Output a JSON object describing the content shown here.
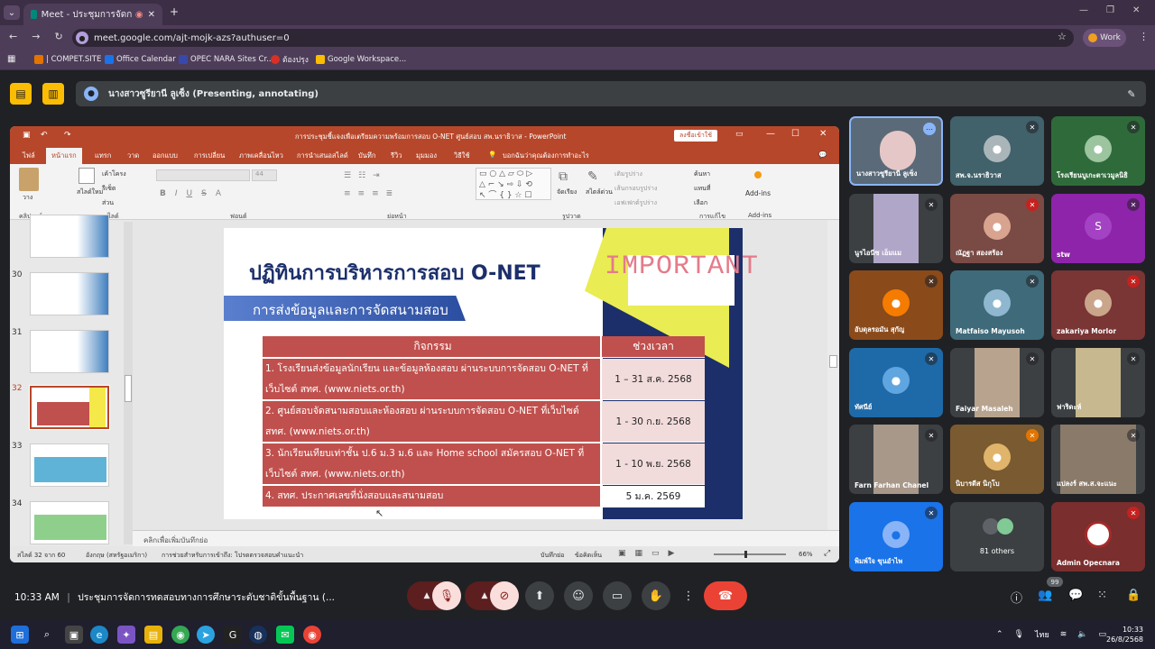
{
  "browser": {
    "tab_title": "Meet - ประชุมการจัดการทดสอบ...",
    "url": "meet.google.com/ajt-mojk-azs?authuser=0",
    "profile_label": "Work",
    "bookmarks": [
      "| COMPET.SITE",
      "Office Calendar",
      "OPEC NARA Sites Cr...",
      "ต้องปรุง",
      "Google Workspace..."
    ]
  },
  "meet": {
    "presenter_text": "นางสาวซูรียานี ลูเซ็ง (Presenting, annotating)",
    "time": "10:33 AM",
    "meeting_title": "ประชุมการจัดการทดสอบทางการศึกษาระดับชาติขั้นพื้นฐาน (...",
    "people_badge": "99"
  },
  "ppt": {
    "title": "การประชุมชี้แจงเพื่อเตรียมความพร้อมการสอบ O-NET ศูนย์สอบ สพ.นราธิวาส - PowerPoint",
    "share_button": "ลงชื่อเข้าใช้",
    "menu": [
      "ไฟล์",
      "หน้าแรก",
      "แทรก",
      "วาด",
      "ออกแบบ",
      "การเปลี่ยน",
      "ภาพเคลื่อนไหว",
      "การนำเสนอสไลด์",
      "บันทึก",
      "รีวิว",
      "มุมมอง",
      "วิธีใช้",
      "บอกฉันว่าคุณต้องการทำอะไร"
    ],
    "ribbon_groups": [
      "คลิปบอร์ด",
      "สไลด์",
      "ฟอนต์",
      "ย่อหน้า",
      "รูปวาด",
      "การแก้ไข",
      "Add-ins"
    ],
    "ribbon_items": {
      "paste": "วาง",
      "new_slide": "สไลด์ใหม่",
      "layout": "เค้าโครง",
      "reset": "รีเซ็ต",
      "section": "ส่วน",
      "font_size": "44",
      "find": "ค้นหา",
      "replace": "แทนที่",
      "select": "เลือก",
      "addins": "Add-ins",
      "arrange": "จัดเรียง",
      "quick_styles": "สไตล์ด่วน",
      "shape_fill": "เติมรูปร่าง",
      "shape_outline": "เส้นกรอบรูปร่าง",
      "shape_effects": "เอฟเฟกต์รูปร่าง"
    },
    "slide_numbers": [
      "30",
      "31",
      "32",
      "33",
      "34"
    ],
    "notes_placeholder": "คลิกเพื่อเพิ่มบันทึกย่อ",
    "status": {
      "slide": "สไลด์ 32 จาก 60",
      "language": "อังกฤษ (สหรัฐอเมริกา)",
      "accessibility": "การช่วยสำหรับการเข้าถึง: โปรดตรวจสอบคำแนะนำ",
      "notes": "บันทึกย่อ",
      "comments": "ข้อคิดเห็น",
      "zoom": "66%"
    }
  },
  "slide": {
    "title": "ปฏิทินการบริหารการสอบ O-NET",
    "subtitle": "การส่งข้อมูลและการจัดสนามสอบ",
    "important": "IMPORTANT",
    "table": {
      "headers": [
        "กิจกรรม",
        "ช่วงเวลา"
      ],
      "rows": [
        {
          "activity": "1. โรงเรียนส่งข้อมูลนักเรียน และข้อมูลห้องสอบ ผ่านระบบการจัดสอบ O-NET ที่เว็บไซต์ สทศ. (www.niets.or.th)",
          "period": "1 – 31 ส.ค. 2568"
        },
        {
          "activity": "2. ศูนย์สอบจัดสนามสอบและห้องสอบ ผ่านระบบการจัดสอบ O-NET ที่เว็บไซต์ สทศ. (www.niets.or.th)",
          "period": "1 - 30 ก.ย. 2568"
        },
        {
          "activity": "3. นักเรียนเทียบเท่าชั้น ป.6 ม.3 ม.6 และ Home school สมัครสอบ O-NET ที่เว็บไซต์ สทศ. (www.niets.or.th)",
          "period": "1 - 10 พ.ย. 2568"
        },
        {
          "activity": "4. สทศ. ประกาศเลขที่นั่งสอบและสนามสอบ",
          "period": "5 ม.ค. 2569"
        }
      ]
    }
  },
  "participants": [
    {
      "name": "นางสาวซูรียานี ลูเซ็ง",
      "muted": false,
      "initial": ""
    },
    {
      "name": "สพ.จ.นราธิวาส",
      "muted": true,
      "initial": ""
    },
    {
      "name": "โรงเรียนบูเกะตาเวมูลนิธิ",
      "muted": true,
      "initial": ""
    },
    {
      "name": "นูรไอนีซ เอ็มแม",
      "muted": true,
      "initial": ""
    },
    {
      "name": "ณัฏฐา สองสร้อง",
      "muted": true,
      "initial": ""
    },
    {
      "name": "stw",
      "muted": true,
      "initial": "S"
    },
    {
      "name": "อับดุลรอมัน สุกัญ",
      "muted": true,
      "initial": ""
    },
    {
      "name": "Matfaiso Mayusoh",
      "muted": true,
      "initial": ""
    },
    {
      "name": "zakariya Morlor",
      "muted": true,
      "initial": ""
    },
    {
      "name": "ทัศนีย์",
      "muted": true,
      "initial": ""
    },
    {
      "name": "Faiyar Masaleh",
      "muted": true,
      "initial": ""
    },
    {
      "name": "ฟาริดะห์",
      "muted": true,
      "initial": ""
    },
    {
      "name": "Farn Farhan Chanel",
      "muted": true,
      "initial": ""
    },
    {
      "name": "นิบารดีส นิกุโบ",
      "muted": true,
      "initial": ""
    },
    {
      "name": "แปลงร์ สพ.ส.จะแนะ",
      "muted": true,
      "initial": ""
    },
    {
      "name": "พิมพ์ใจ ขุนอำไพ",
      "muted": true,
      "initial": ""
    },
    {
      "name": "81 others",
      "muted": false,
      "initial": ""
    },
    {
      "name": "Admin Opecnara",
      "muted": true,
      "initial": ""
    }
  ],
  "taskbar": {
    "time": "10:33",
    "date": "26/8/2568",
    "lang": "ไทย"
  },
  "colors": {
    "accent_red": "#ea4335",
    "ppt_red": "#b7472a",
    "table_red": "#c0504d"
  }
}
